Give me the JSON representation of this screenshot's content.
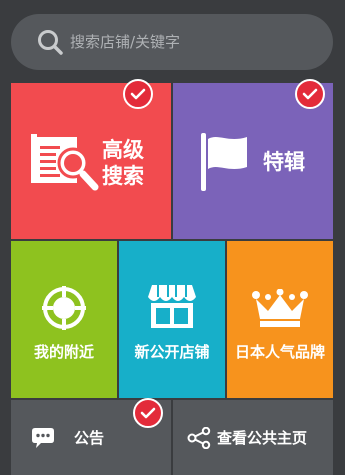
{
  "search": {
    "placeholder": "搜索店铺/关键字",
    "icon": "search-icon"
  },
  "tiles": {
    "advanced_search": {
      "line1": "高级",
      "line2": "搜索",
      "icon": "document-magnifier-icon",
      "color": "#f24b4f",
      "selected": true
    },
    "special": {
      "label": "特辑",
      "icon": "flag-icon",
      "color": "#7b63b9",
      "selected": true
    },
    "nearby": {
      "label": "我的附近",
      "icon": "crosshair-icon",
      "color": "#8ec21f"
    },
    "new_stores": {
      "label": "新公开店铺",
      "icon": "storefront-icon",
      "color": "#17afc9"
    },
    "japan_popular": {
      "label": "日本人气品牌",
      "icon": "crown-icon",
      "color": "#f7931d"
    },
    "notice": {
      "label": "公告",
      "icon": "chat-bubble-icon",
      "selected": true
    },
    "public_home": {
      "label": "查看公共主页",
      "icon": "share-icon"
    }
  }
}
